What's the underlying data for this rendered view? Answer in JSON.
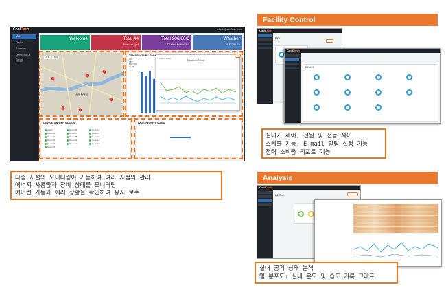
{
  "dashboard": {
    "brand": {
      "main": "Cool",
      "accent": "Dash"
    },
    "user": "admin@coolsec.com",
    "sidebar": [
      "Main",
      "Device",
      "Schedule",
      "Distribution & Report",
      "Report"
    ],
    "cards": [
      {
        "title": "Welcome",
        "sub": "",
        "color": "#19a37a"
      },
      {
        "title": "Total 44",
        "sub": "Sites Managed",
        "color": "#c23446"
      },
      {
        "title": "Total 206/80/6",
        "sub": "ID1/ODU/WIND/ERR",
        "color": "#7a3f9c"
      },
      {
        "title": "Weather",
        "sub": "26.7°C 53.0%",
        "color": "#4a79b8"
      }
    ],
    "map_tabs": [
      "지도",
      "위성"
    ],
    "map_city": "서울특별시",
    "temp_title": "TEMPERATURE TREND",
    "temp_legend": [
      "DEV",
      "SET",
      "FACTORY",
      "SLAB"
    ],
    "detail_title": "Detailed Trend",
    "detail_legend": "Indoor temp",
    "device_status_title": "DEVICE ON/OFF STATUS",
    "idu_status_title": "IDU ON/OFF STATUS",
    "status_items": [
      "HEAT",
      "Room01",
      "Room02",
      "Room03",
      "Room04",
      "Room05",
      "Room06",
      "Room07",
      "Room08",
      "Room09",
      "Room10",
      "Room11",
      "Room12",
      "Room13",
      "Room14",
      "Room15"
    ]
  },
  "facility": {
    "header": "Facility Control",
    "shot1_label": "DEV",
    "shot2_label": "DEVICE",
    "desc": [
      "실내기 제어, 전원 및 전등 제어",
      "스케줄 기능, E-mail 알림 설정 기능",
      "전력 소비량 리포트 기능"
    ]
  },
  "analysis": {
    "header": "Analysis",
    "shot_label": "DEVICE",
    "desc": [
      "실내 공기 상태 분석",
      "열 분포도: 실내 온도 및 습도 기록 그래프"
    ]
  },
  "main_desc": [
    "다중 시설의 모니터링이 가능하여 여러 지점의 관리",
    "에너지 사용량과 장비 상태를 모니터링",
    "에어컨 가동과 에러 상황을 확인하여 유지 보수"
  ],
  "colors": {
    "accent": "#e8782d",
    "blue": "#2f6fb8"
  }
}
